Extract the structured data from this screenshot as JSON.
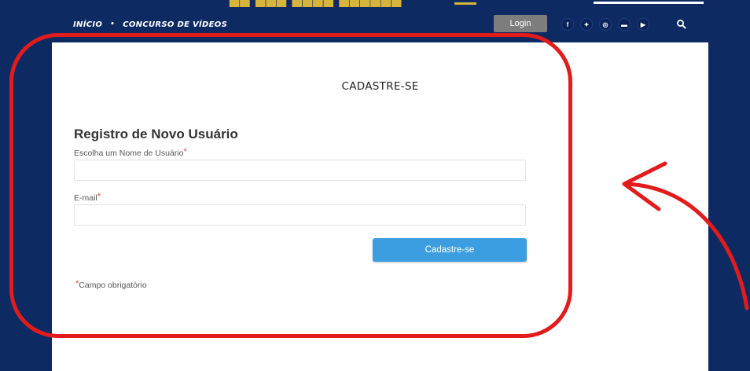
{
  "header": {
    "nav": [
      {
        "label": "INÍCIO"
      },
      {
        "label": "CONCURSO DE VÍDEOS"
      }
    ],
    "nav_separator": "•",
    "login_label": "Login",
    "social_icons": [
      {
        "name": "facebook-icon",
        "glyph": "f"
      },
      {
        "name": "twitter-icon",
        "glyph": "✦"
      },
      {
        "name": "instagram-icon",
        "glyph": "◎"
      },
      {
        "name": "flickr-icon",
        "glyph": "▬"
      },
      {
        "name": "youtube-icon",
        "glyph": "▶"
      }
    ],
    "search_icon": "search-icon"
  },
  "page": {
    "title": "CADASTRE-SE"
  },
  "form": {
    "heading": "Registro de Novo Usuário",
    "username_label": "Escolha um Nome de Usuário",
    "username_value": "",
    "email_label": "E-mail",
    "email_value": "",
    "required_marker": "*",
    "submit_label": "Cadastre-se",
    "required_note": "Campo obrigatório"
  },
  "colors": {
    "background": "#0d2a63",
    "login_button": "#7d7d7d",
    "submit_button": "#3b9ee0",
    "required": "#e8452c",
    "annotation": "#e41b1b"
  }
}
